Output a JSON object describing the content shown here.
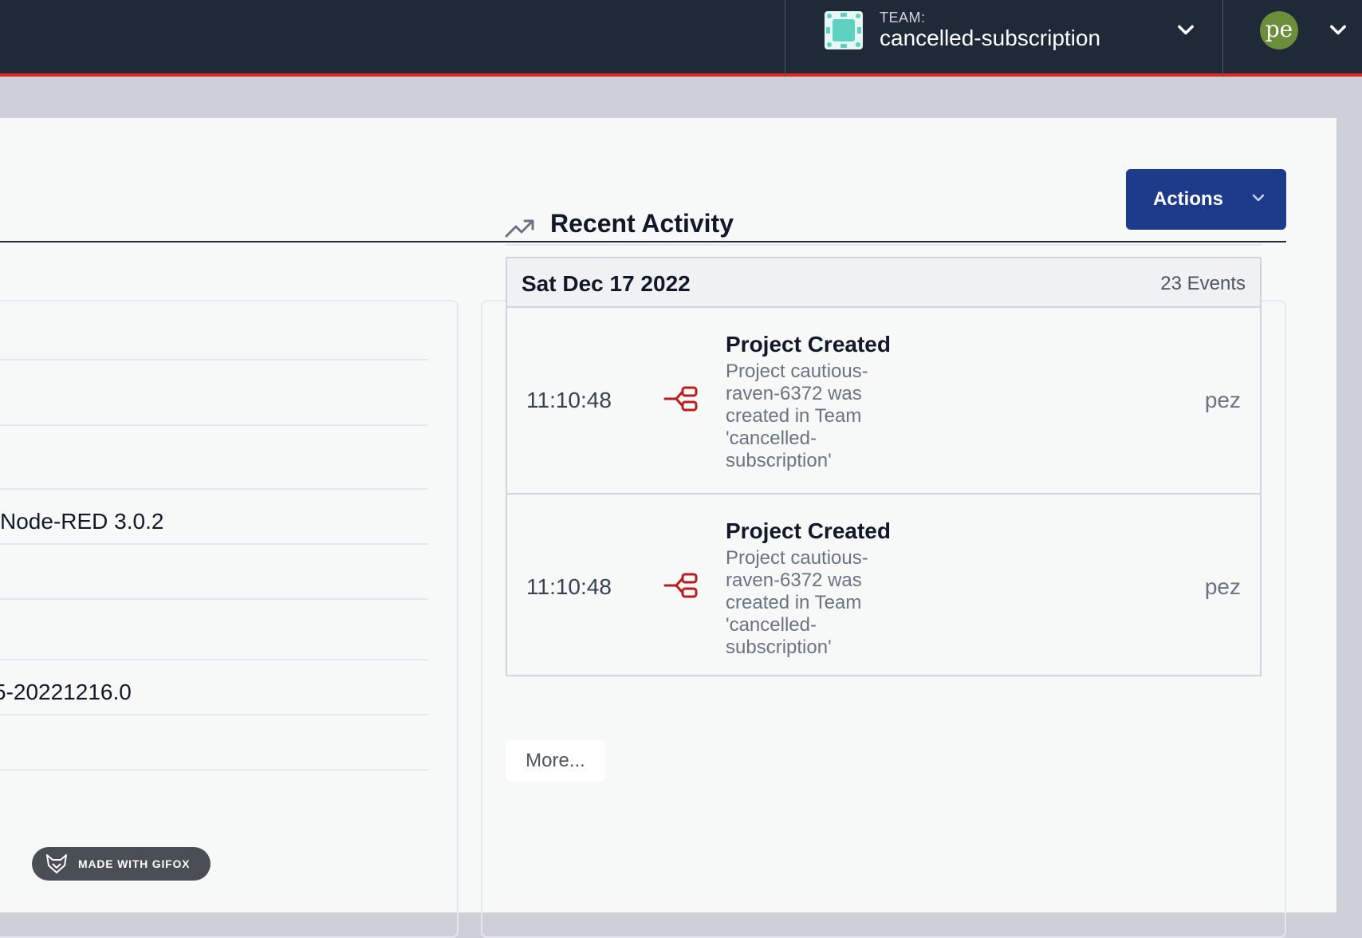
{
  "header": {
    "team_caption": "TEAM:",
    "team_name": "cancelled-subscription",
    "avatar_initials": "pe",
    "accent_color": "#dc2626",
    "background_color": "#1f2937"
  },
  "toolbar": {
    "actions_label": "Actions"
  },
  "left_panel": {
    "node_red_version": "Node-RED 3.0.2",
    "launcher_version": "5-20221216.0"
  },
  "recent_activity": {
    "title": "Recent Activity",
    "icon": "trending-up-icon",
    "groups": [
      {
        "date": "Sat Dec 17 2022",
        "count": "23 Events",
        "events": [
          {
            "time": "11:10:48",
            "icon": "project-flow-icon",
            "title": "Project Created",
            "description": "Project cautious-raven-6372 was created in Team 'cancelled-subscription'",
            "user": "pez"
          },
          {
            "time": "11:10:48",
            "icon": "project-flow-icon",
            "title": "Project Created",
            "description": "Project cautious-raven-6372 was created in Team 'cancelled-subscription'",
            "user": "pez"
          }
        ]
      }
    ],
    "more_label": "More..."
  },
  "watermark": {
    "text": "MADE WITH GIFOX"
  }
}
